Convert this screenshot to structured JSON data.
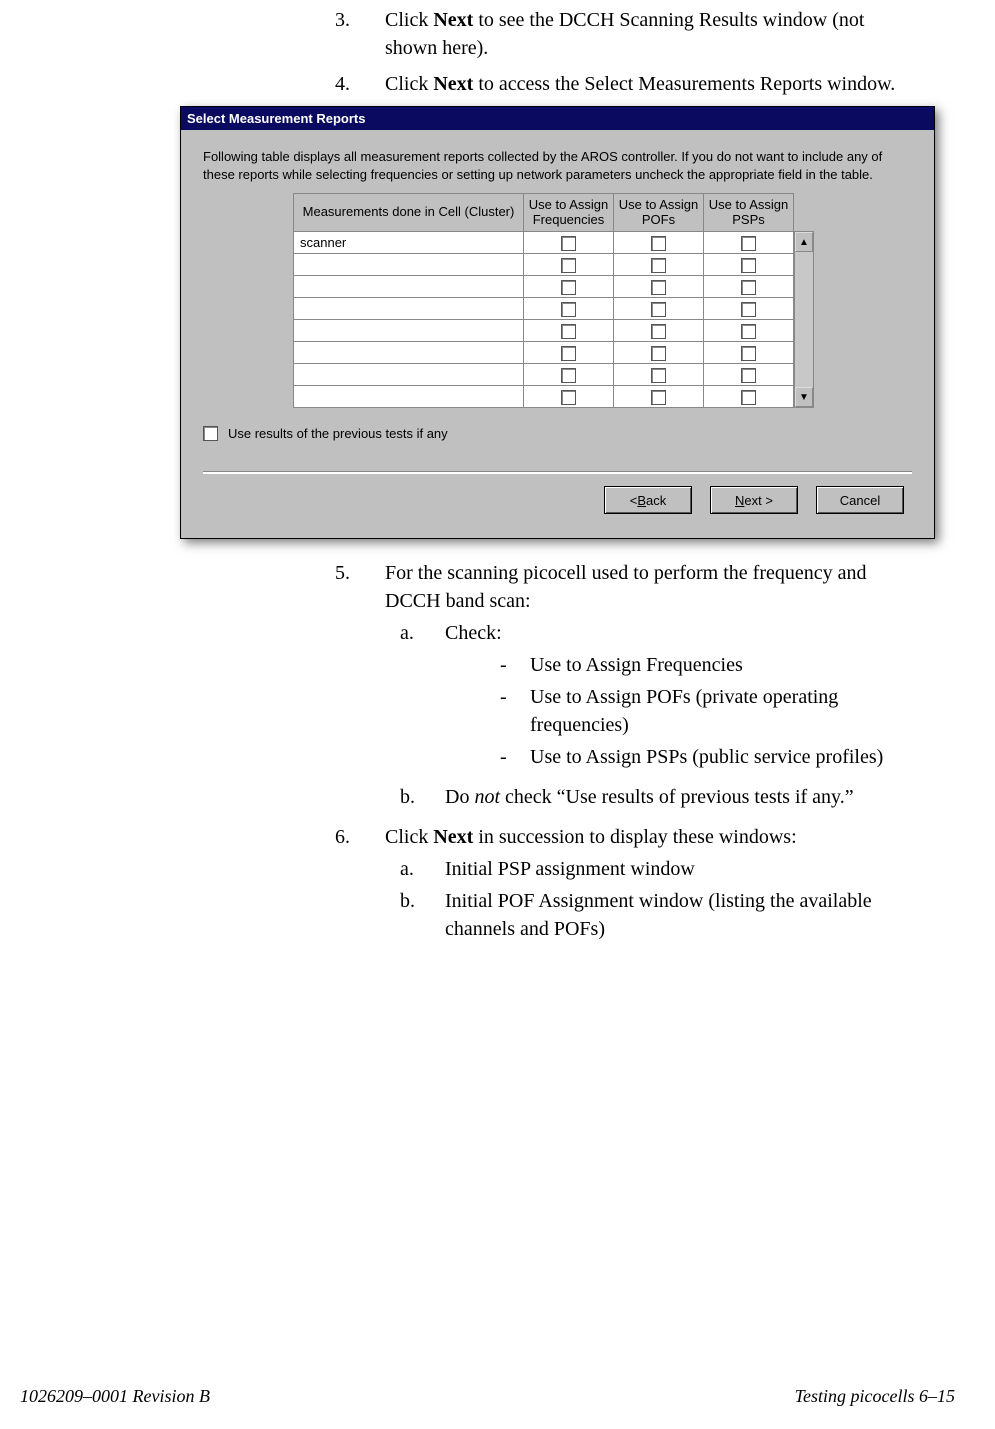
{
  "steps": {
    "s3": {
      "num": "3.",
      "pre": "Click ",
      "bold": "Next",
      "post": " to see the DCCH  Scanning Results window (not shown here)."
    },
    "s4": {
      "num": "4.",
      "pre": "Click ",
      "bold": "Next",
      "post": " to access the Select Measurements Reports window."
    },
    "s5": {
      "num": "5.",
      "text": "For the scanning picocell used to perform the frequency and DCCH band scan:",
      "a": {
        "num": "a.",
        "text": "Check:",
        "d1": "Use to Assign Frequencies",
        "d2": "Use to Assign POFs (private operating frequencies)",
        "d3": "Use to Assign PSPs (public service profiles)"
      },
      "b": {
        "num": "b.",
        "pre": "Do ",
        "italic": "not",
        "post": " check “Use results of previous tests if any.”"
      }
    },
    "s6": {
      "num": "6.",
      "pre": "Click ",
      "bold": "Next",
      "post": " in succession to display these windows:",
      "a": {
        "num": "a.",
        "text": "Initial PSP assignment window"
      },
      "b": {
        "num": "b.",
        "text": "Initial POF Assignment window (listing the available channels and POFs)"
      }
    }
  },
  "dialog": {
    "title": "Select Measurement Reports",
    "description": "Following table displays all measurement reports collected by the AROS controller.  If you do not want to include any of these reports while selecting frequencies or setting up network parameters uncheck the appropriate field in the table.",
    "headers": {
      "c1": "Measurements done in Cell (Cluster)",
      "c2": "Use to Assign Frequencies",
      "c3": "Use to Assign POFs",
      "c4": "Use to Assign PSPs"
    },
    "rows": {
      "r0": "scanner",
      "r1": "",
      "r2": "",
      "r3": "",
      "r4": "",
      "r5": "",
      "r6": "",
      "r7": ""
    },
    "prev_checkbox_label": "Use results of the previous tests if any",
    "buttons": {
      "back_pre": "< ",
      "back_u": "B",
      "back_post": "ack",
      "next_u": "N",
      "next_post": "ext >",
      "cancel": "Cancel"
    }
  },
  "footer": {
    "left": "1026209–0001  Revision B",
    "right": "Testing picocells   6–15"
  }
}
